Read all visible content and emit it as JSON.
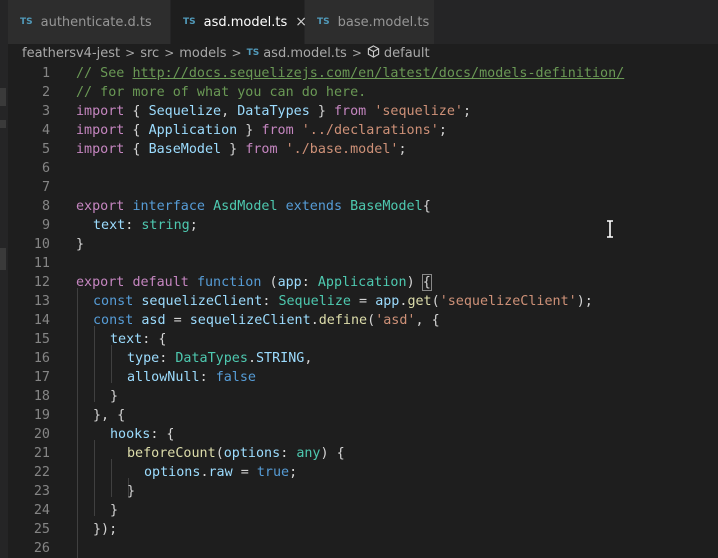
{
  "tabs": [
    {
      "type_badge": "TS",
      "label": "authenticate.d.ts",
      "active": false
    },
    {
      "type_badge": "TS",
      "label": "asd.model.ts",
      "active": true,
      "close": "×"
    },
    {
      "type_badge": "TS",
      "label": "base.model.ts",
      "active": false
    }
  ],
  "breadcrumb": {
    "items": [
      "feathersv4-jest",
      "src",
      "models",
      "asd.model.ts",
      "default"
    ],
    "separator": ">",
    "file_badge": "TS",
    "symbol_icon": "cube-icon"
  },
  "editor": {
    "line_numbers": [
      "1",
      "2",
      "3",
      "4",
      "5",
      "6",
      "7",
      "8",
      "9",
      "10",
      "11",
      "12",
      "13",
      "14",
      "15",
      "16",
      "17",
      "18",
      "19",
      "20",
      "21",
      "22",
      "23",
      "24",
      "25",
      "26"
    ],
    "lines": {
      "l1": {
        "a": "// See ",
        "b": "http://docs.sequelizejs.com/en/latest/docs/models-definition/"
      },
      "l2": {
        "a": "// for more of what you can do here."
      },
      "l3": {
        "a": "import",
        "b": " { ",
        "c": "Sequelize",
        "d": ", ",
        "e": "DataTypes",
        "f": " } ",
        "g": "from",
        "h": " ",
        "i": "'sequelize'",
        "j": ";"
      },
      "l4": {
        "a": "import",
        "b": " { ",
        "c": "Application",
        "d": " } ",
        "e": "from",
        "f": " ",
        "g": "'../declarations'",
        "h": ";"
      },
      "l5": {
        "a": "import",
        "b": " { ",
        "c": "BaseModel",
        "d": " } ",
        "e": "from",
        "f": " ",
        "g": "'./base.model'",
        "h": ";"
      },
      "l8": {
        "a": "export",
        "b": " ",
        "c": "interface",
        "d": " ",
        "e": "AsdModel",
        "f": " ",
        "g": "extends",
        "h": " ",
        "i": "BaseModel",
        "j": "{"
      },
      "l9": {
        "a": "text",
        "b": ": ",
        "c": "string",
        "d": ";"
      },
      "l10": {
        "a": "}"
      },
      "l12": {
        "a": "export",
        "b": " ",
        "c": "default",
        "d": " ",
        "e": "function",
        "f": " (",
        "g": "app",
        "h": ": ",
        "i": "Application",
        "j": ") ",
        "k": "{"
      },
      "l13": {
        "a": "const",
        "b": " ",
        "c": "sequelizeClient",
        "d": ": ",
        "e": "Sequelize",
        "f": " = ",
        "g": "app",
        "h": ".",
        "i": "get",
        "j": "(",
        "k": "'sequelizeClient'",
        "l": ");"
      },
      "l14": {
        "a": "const",
        "b": " ",
        "c": "asd",
        "d": " = ",
        "e": "sequelizeClient",
        "f": ".",
        "g": "define",
        "h": "(",
        "i": "'asd'",
        "j": ", {"
      },
      "l15": {
        "a": "text",
        "b": ": {"
      },
      "l16": {
        "a": "type",
        "b": ": ",
        "c": "DataTypes",
        "d": ".",
        "e": "STRING",
        "f": ","
      },
      "l17": {
        "a": "allowNull",
        "b": ": ",
        "c": "false"
      },
      "l18": {
        "a": "}"
      },
      "l19": {
        "a": "}, {"
      },
      "l20": {
        "a": "hooks",
        "b": ": {"
      },
      "l21": {
        "a": "beforeCount",
        "b": "(",
        "c": "options",
        "d": ": ",
        "e": "any",
        "f": ") {"
      },
      "l22": {
        "a": "options",
        "b": ".",
        "c": "raw",
        "d": " = ",
        "e": "true",
        "f": ";"
      },
      "l23": {
        "a": "}"
      },
      "l24": {
        "a": "}"
      },
      "l25": {
        "a": "});"
      }
    }
  }
}
